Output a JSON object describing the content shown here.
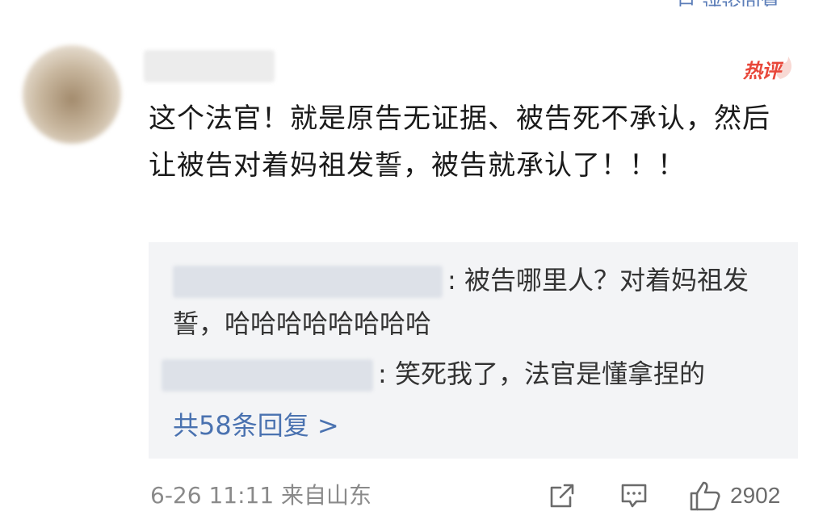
{
  "top_partial": "已 评论回复",
  "comment": {
    "hot_label": "热评",
    "text": "这个法官！就是原告无证据、被告死不承认，然后让被告对着妈祖发誓，被告就承认了！！！"
  },
  "replies": [
    {
      "separator": ":",
      "text": " 被告哪里人？对着妈祖发誓，哈哈哈哈哈哈哈哈"
    },
    {
      "separator": ":",
      "text": " 笑死我了，法官是懂拿捏的"
    }
  ],
  "more_replies": "共58条回复 >",
  "footer": {
    "date_location": "6-26 11:11 来自山东",
    "like_count": "2902"
  },
  "icons": {
    "share": "share-icon",
    "comment": "comment-icon",
    "like": "thumbs-up-icon"
  },
  "colors": {
    "link": "#4a72b0",
    "hot": "#e8473a",
    "reply_bg": "#f3f4f6"
  }
}
